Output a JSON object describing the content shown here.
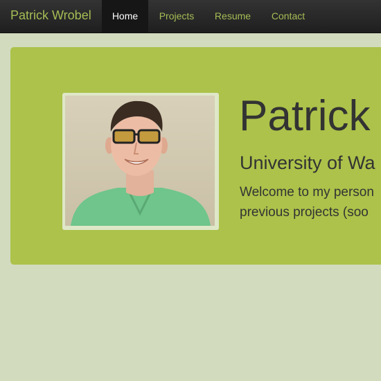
{
  "navbar": {
    "brand": "Patrick Wrobel",
    "items": [
      {
        "label": "Home",
        "active": true
      },
      {
        "label": "Projects",
        "active": false
      },
      {
        "label": "Resume",
        "active": false
      },
      {
        "label": "Contact",
        "active": false
      }
    ]
  },
  "hero": {
    "title": "Patrick",
    "subtitle": "University of Wa",
    "intro_line1": "Welcome to my person",
    "intro_line2": "previous projects (soo"
  },
  "colors": {
    "page_background": "#d3dbbf",
    "navbar_background": "#2a2a2a",
    "accent_green": "#a5bd55",
    "hero_background": "#acc24a",
    "text_dark": "#333333"
  }
}
